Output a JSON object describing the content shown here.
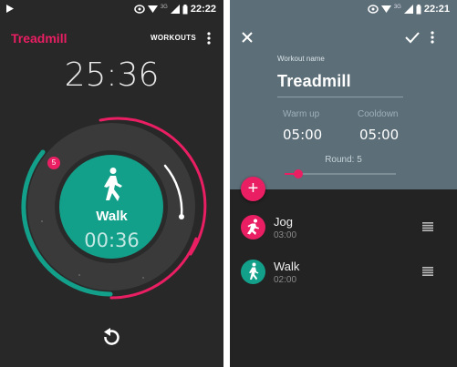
{
  "left_screen": {
    "status": {
      "time": "22:22",
      "network": "3G"
    },
    "app_title": "Treadmill",
    "workouts_button": "WORKOUTS",
    "main_timer": "25:36",
    "round_badge": "5",
    "current_step": {
      "name": "Walk",
      "remaining": "00:36",
      "icon": "walk-icon"
    },
    "reset_icon": "reset-icon"
  },
  "right_screen": {
    "status": {
      "time": "22:21",
      "network": "3G"
    },
    "workout_name_label": "Workout name",
    "workout_name": "Treadmill",
    "warm_up": {
      "label": "Warm up",
      "value": "05:00"
    },
    "cooldown": {
      "label": "Cooldown",
      "value": "05:00"
    },
    "round_label": "Round: 5",
    "round_progress": 0.12,
    "add_button": "+",
    "steps": [
      {
        "name": "Jog",
        "duration": "03:00",
        "color": "#e91e63"
      },
      {
        "name": "Walk",
        "duration": "02:00",
        "color": "#13a08a"
      }
    ]
  },
  "colors": {
    "accent": "#e91e63",
    "teal": "#13a08a",
    "header": "#5c6e78",
    "background": "#282828"
  }
}
